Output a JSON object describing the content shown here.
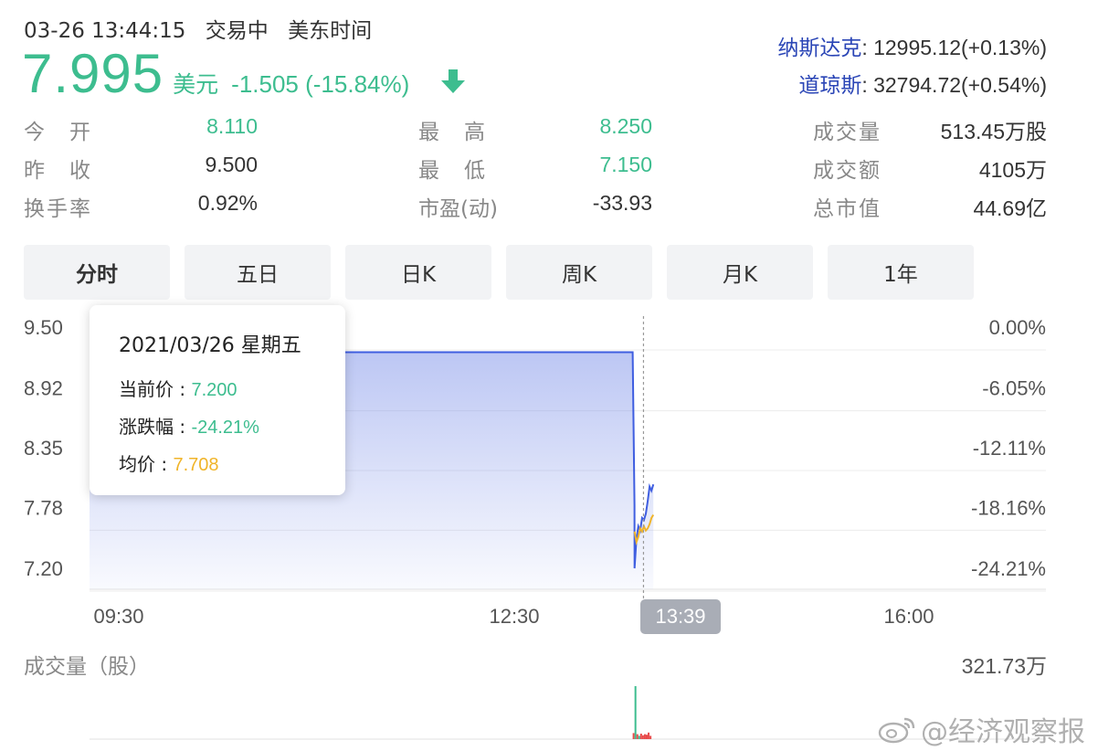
{
  "header": {
    "datetime": "03-26 13:44:15",
    "trade_status": "交易中",
    "timezone": "美东时间",
    "price": "7.995",
    "currency": "美元",
    "change": "-1.505 (-15.84%)",
    "trend_icon": "arrow-down-icon"
  },
  "indices": [
    {
      "name": "纳斯达克",
      "value": ": 12995.12(+0.13%)"
    },
    {
      "name": "道琼斯",
      "value": ": 32794.72(+0.54%)"
    }
  ],
  "stats": {
    "open_label": "今　开",
    "open": "8.110",
    "prev_close_label": "昨　收",
    "prev_close": "9.500",
    "turnover_label": "换手率",
    "turnover": "0.92%",
    "high_label": "最　高",
    "high": "8.250",
    "low_label": "最　低",
    "low": "7.150",
    "pe_label": "市盈(动)",
    "pe": "-33.93",
    "volume_label": "成交量",
    "volume": "513.45万股",
    "amount_label": "成交额",
    "amount": "4105万",
    "market_cap_label": "总市值",
    "market_cap": "44.69亿"
  },
  "tabs": [
    "分时",
    "五日",
    "日K",
    "周K",
    "月K",
    "1年"
  ],
  "active_tab": "分时",
  "tooltip": {
    "date": "2021/03/26 星期五",
    "price_label": "当前价 : ",
    "price": "7.200",
    "change_label": "涨跌幅 : ",
    "change": "-24.21%",
    "avg_label": "均价 : ",
    "avg": "7.708"
  },
  "crosshair_time": "13:39",
  "volume_title": "成交量（股）",
  "volume_max": "321.73万",
  "watermark": "@经济观察报",
  "colors": {
    "down": "#3dbd8f",
    "up": "#e84a4a",
    "price_line": "#3f5ee0",
    "avg_line": "#f0b429",
    "index_link": "#2a45b6"
  },
  "chart_data": {
    "type": "line",
    "x_ticks": [
      "09:30",
      "12:30",
      "16:00"
    ],
    "y_ticks_left": [
      "9.50",
      "8.92",
      "8.35",
      "7.78",
      "7.20"
    ],
    "y_ticks_right": [
      "0.00%",
      "-6.05%",
      "-12.11%",
      "-18.16%",
      "-24.21%"
    ],
    "ylim": [
      7.2,
      9.5
    ],
    "prev_close": 9.5,
    "series": [
      {
        "x": [
          "09:30",
          "13:33",
          "13:33",
          "13:34",
          "13:35",
          "13:36",
          "13:37",
          "13:38",
          "13:39",
          "13:40",
          "13:41",
          "13:42",
          "13:43",
          "13:44"
        ],
        "values": [
          9.26,
          9.26,
          7.8,
          7.2,
          7.48,
          7.6,
          7.56,
          7.68,
          7.66,
          7.72,
          7.84,
          7.98,
          7.94,
          8.0
        ]
      },
      {
        "x": [
          "13:34",
          "13:35",
          "13:36",
          "13:37",
          "13:38",
          "13:39",
          "13:40",
          "13:41",
          "13:42",
          "13:43",
          "13:44"
        ],
        "values": [
          7.55,
          7.45,
          7.5,
          7.58,
          7.55,
          7.6,
          7.56,
          7.58,
          7.62,
          7.68,
          7.71
        ]
      }
    ],
    "volume_bars": [
      {
        "x": "13:33",
        "color": "up",
        "value": 1.1
      },
      {
        "x": "13:34",
        "color": "down",
        "value": 3217300
      },
      {
        "x": "13:35",
        "color": "up",
        "value": 0.9
      },
      {
        "x": "13:36",
        "color": "down",
        "value": 0.6
      },
      {
        "x": "13:37",
        "color": "up",
        "value": 1.0
      },
      {
        "x": "13:38",
        "color": "up",
        "value": 0.7
      },
      {
        "x": "13:39",
        "color": "up",
        "value": 0.9
      },
      {
        "x": "13:40",
        "color": "up",
        "value": 0.8
      },
      {
        "x": "13:41",
        "color": "up",
        "value": 1.2
      },
      {
        "x": "13:42",
        "color": "up",
        "value": 0.6
      }
    ]
  }
}
